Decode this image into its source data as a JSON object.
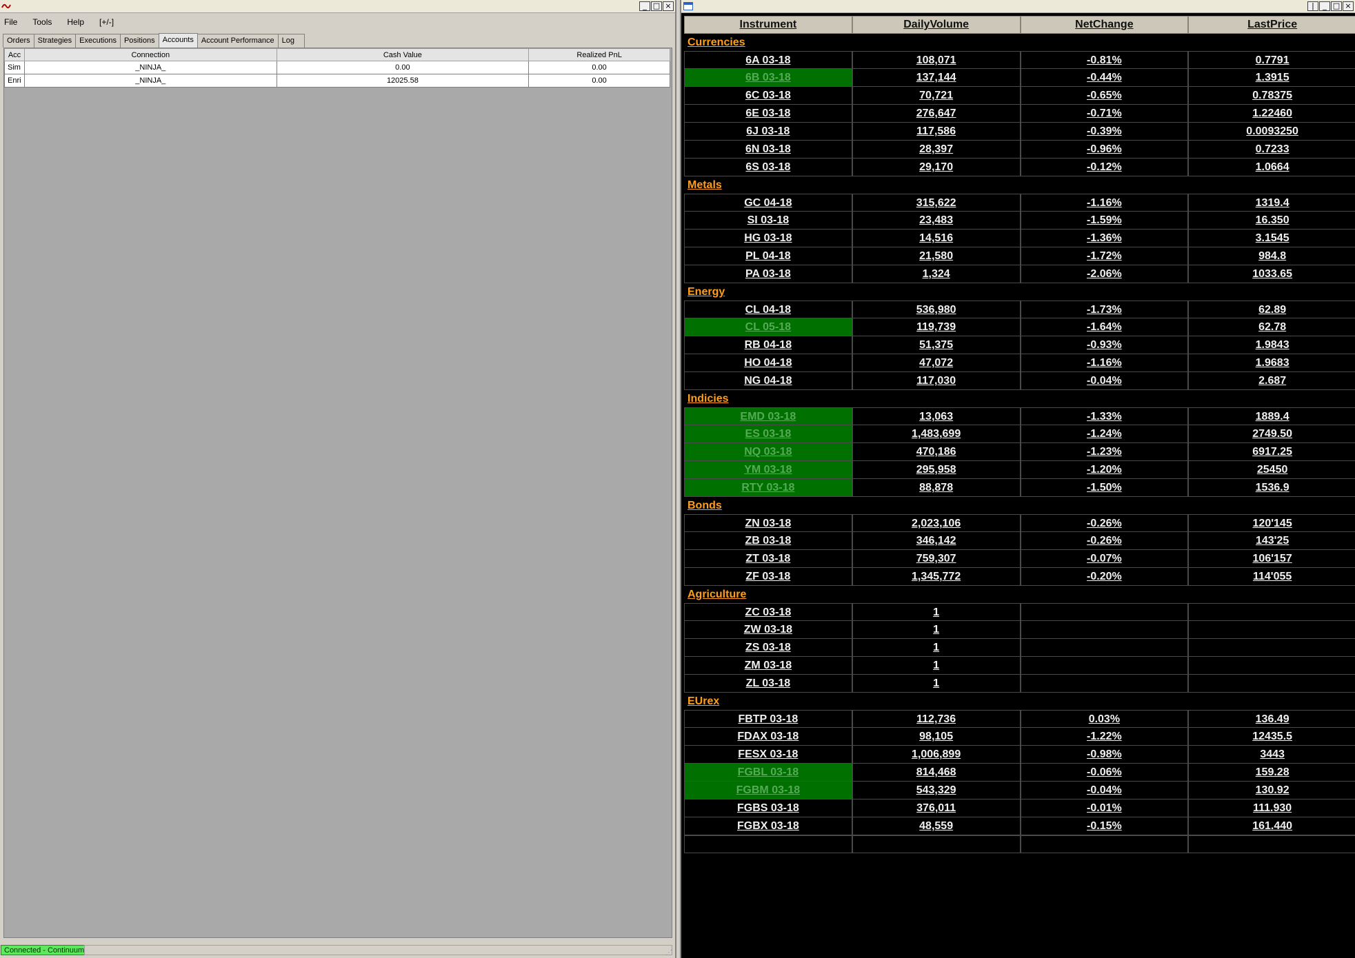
{
  "left_window": {
    "menu": [
      "File",
      "Tools",
      "Help",
      "[+/-]"
    ],
    "tabs": [
      "Orders",
      "Strategies",
      "Executions",
      "Positions",
      "Accounts",
      "Account Performance",
      "Log"
    ],
    "active_tab": "Accounts",
    "columns": [
      "Acc",
      "Connection",
      "Cash Value",
      "Realized PnL"
    ],
    "rows": [
      [
        "Sim",
        "_NINJA_",
        "0.00",
        "0.00"
      ],
      [
        "Enri",
        "_NINJA_",
        "12025.58",
        "0.00"
      ]
    ],
    "status": "Connected - Continuum"
  },
  "right_window": {
    "columns": [
      "Instrument",
      "DailyVolume",
      "NetChange",
      "LastPrice"
    ],
    "highlight_color": "#007000",
    "group_color": "#ff9e1a",
    "groups": [
      {
        "name": "Currencies",
        "rows": [
          {
            "instrument": "6A 03-18",
            "volume": "108,071",
            "change": "-0.81%",
            "price": "0.7791",
            "hl": false
          },
          {
            "instrument": "6B 03-18",
            "volume": "137,144",
            "change": "-0.44%",
            "price": "1.3915",
            "hl": true
          },
          {
            "instrument": "6C 03-18",
            "volume": "70,721",
            "change": "-0.65%",
            "price": "0.78375",
            "hl": false
          },
          {
            "instrument": "6E 03-18",
            "volume": "276,647",
            "change": "-0.71%",
            "price": "1.22460",
            "hl": false
          },
          {
            "instrument": "6J 03-18",
            "volume": "117,586",
            "change": "-0.39%",
            "price": "0.0093250",
            "hl": false
          },
          {
            "instrument": "6N 03-18",
            "volume": "28,397",
            "change": "-0.96%",
            "price": "0.7233",
            "hl": false
          },
          {
            "instrument": "6S 03-18",
            "volume": "29,170",
            "change": "-0.12%",
            "price": "1.0664",
            "hl": false
          }
        ]
      },
      {
        "name": "Metals",
        "rows": [
          {
            "instrument": "GC 04-18",
            "volume": "315,622",
            "change": "-1.16%",
            "price": "1319.4",
            "hl": false
          },
          {
            "instrument": "SI 03-18",
            "volume": "23,483",
            "change": "-1.59%",
            "price": "16.350",
            "hl": false
          },
          {
            "instrument": "HG 03-18",
            "volume": "14,516",
            "change": "-1.36%",
            "price": "3.1545",
            "hl": false
          },
          {
            "instrument": "PL 04-18",
            "volume": "21,580",
            "change": "-1.72%",
            "price": "984.8",
            "hl": false
          },
          {
            "instrument": "PA 03-18",
            "volume": "1,324",
            "change": "-2.06%",
            "price": "1033.65",
            "hl": false
          }
        ]
      },
      {
        "name": "Energy",
        "rows": [
          {
            "instrument": "CL 04-18",
            "volume": "536,980",
            "change": "-1.73%",
            "price": "62.89",
            "hl": false
          },
          {
            "instrument": "CL 05-18",
            "volume": "119,739",
            "change": "-1.64%",
            "price": "62.78",
            "hl": true
          },
          {
            "instrument": "RB 04-18",
            "volume": "51,375",
            "change": "-0.93%",
            "price": "1.9843",
            "hl": false
          },
          {
            "instrument": "HO 04-18",
            "volume": "47,072",
            "change": "-1.16%",
            "price": "1.9683",
            "hl": false
          },
          {
            "instrument": "NG 04-18",
            "volume": "117,030",
            "change": "-0.04%",
            "price": "2.687",
            "hl": false
          }
        ]
      },
      {
        "name": "Indicies",
        "rows": [
          {
            "instrument": "EMD 03-18",
            "volume": "13,063",
            "change": "-1.33%",
            "price": "1889.4",
            "hl": true
          },
          {
            "instrument": "ES 03-18",
            "volume": "1,483,699",
            "change": "-1.24%",
            "price": "2749.50",
            "hl": true
          },
          {
            "instrument": "NQ 03-18",
            "volume": "470,186",
            "change": "-1.23%",
            "price": "6917.25",
            "hl": true
          },
          {
            "instrument": "YM 03-18",
            "volume": "295,958",
            "change": "-1.20%",
            "price": "25450",
            "hl": true
          },
          {
            "instrument": "RTY 03-18",
            "volume": "88,878",
            "change": "-1.50%",
            "price": "1536.9",
            "hl": true
          }
        ]
      },
      {
        "name": "Bonds",
        "rows": [
          {
            "instrument": "ZN 03-18",
            "volume": "2,023,106",
            "change": "-0.26%",
            "price": "120'145",
            "hl": false
          },
          {
            "instrument": "ZB 03-18",
            "volume": "346,142",
            "change": "-0.26%",
            "price": "143'25",
            "hl": false
          },
          {
            "instrument": "ZT 03-18",
            "volume": "759,307",
            "change": "-0.07%",
            "price": "106'157",
            "hl": false
          },
          {
            "instrument": "ZF 03-18",
            "volume": "1,345,772",
            "change": "-0.20%",
            "price": "114'055",
            "hl": false
          }
        ]
      },
      {
        "name": "Agriculture",
        "rows": [
          {
            "instrument": "ZC 03-18",
            "volume": "1",
            "change": "",
            "price": "",
            "hl": false
          },
          {
            "instrument": "ZW 03-18",
            "volume": "1",
            "change": "",
            "price": "",
            "hl": false
          },
          {
            "instrument": "ZS 03-18",
            "volume": "1",
            "change": "",
            "price": "",
            "hl": false
          },
          {
            "instrument": "ZM 03-18",
            "volume": "1",
            "change": "",
            "price": "",
            "hl": false
          },
          {
            "instrument": "ZL 03-18",
            "volume": "1",
            "change": "",
            "price": "",
            "hl": false
          }
        ]
      },
      {
        "name": "EUrex",
        "rows": [
          {
            "instrument": "FBTP 03-18",
            "volume": "112,736",
            "change": "0.03%",
            "price": "136.49",
            "hl": false
          },
          {
            "instrument": "FDAX 03-18",
            "volume": "98,105",
            "change": "-1.22%",
            "price": "12435.5",
            "hl": false
          },
          {
            "instrument": "FESX 03-18",
            "volume": "1,006,899",
            "change": "-0.98%",
            "price": "3443",
            "hl": false
          },
          {
            "instrument": "FGBL 03-18",
            "volume": "814,468",
            "change": "-0.06%",
            "price": "159.28",
            "hl": true
          },
          {
            "instrument": "FGBM 03-18",
            "volume": "543,329",
            "change": "-0.04%",
            "price": "130.92",
            "hl": true
          },
          {
            "instrument": "FGBS 03-18",
            "volume": "376,011",
            "change": "-0.01%",
            "price": "111.930",
            "hl": false
          },
          {
            "instrument": "FGBX 03-18",
            "volume": "48,559",
            "change": "-0.15%",
            "price": "161.440",
            "hl": false
          }
        ]
      }
    ]
  }
}
